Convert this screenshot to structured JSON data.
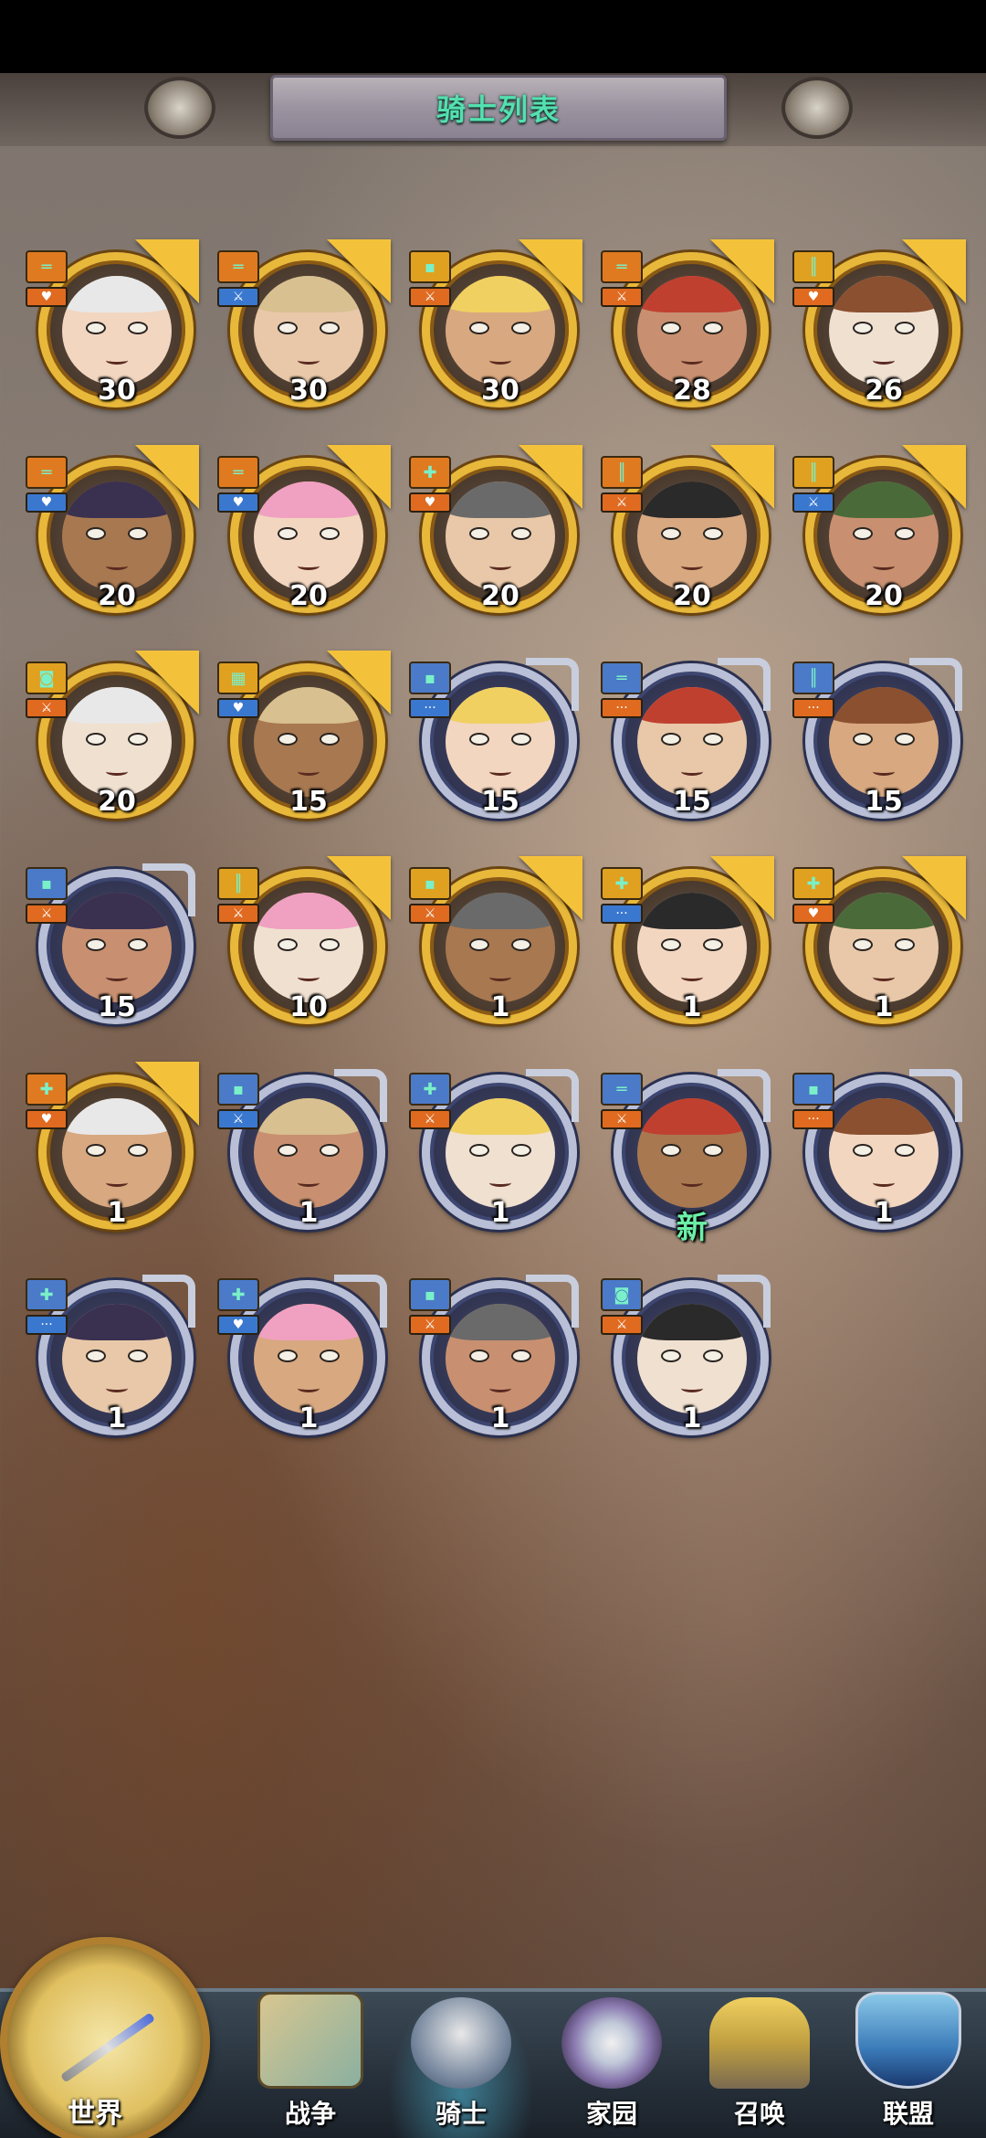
{
  "header": {
    "title": "骑士列表"
  },
  "colors": {
    "rank_green": "#35b58a",
    "rank_gold": "#e0a020",
    "rank_blue": "#4a7ac8",
    "class_orange": "#e06a20",
    "class_blue": "#3a78d0"
  },
  "heroes": [
    {
      "level": "30",
      "frame": "gold",
      "rank": "orange",
      "role": "orange",
      "rank_icon": "bars",
      "role_icon": "heart-icon"
    },
    {
      "level": "30",
      "frame": "gold",
      "rank": "orange",
      "role": "blue",
      "rank_icon": "bars",
      "role_icon": "sword-icon"
    },
    {
      "level": "30",
      "frame": "gold",
      "rank": "gold",
      "role": "orange",
      "rank_icon": "square",
      "role_icon": "sword-icon"
    },
    {
      "level": "28",
      "frame": "gold",
      "rank": "orange",
      "role": "orange",
      "rank_icon": "bars",
      "role_icon": "sword-icon"
    },
    {
      "level": "26",
      "frame": "gold",
      "rank": "gold",
      "role": "orange",
      "rank_icon": "column",
      "role_icon": "heart-icon"
    },
    {
      "level": "20",
      "frame": "gold",
      "rank": "orange",
      "role": "blue",
      "rank_icon": "bars",
      "role_icon": "heart-icon"
    },
    {
      "level": "20",
      "frame": "gold",
      "rank": "orange",
      "role": "blue",
      "rank_icon": "bars",
      "role_icon": "heart-icon"
    },
    {
      "level": "20",
      "frame": "gold",
      "rank": "orange",
      "role": "orange",
      "rank_icon": "cross",
      "role_icon": "heart-icon"
    },
    {
      "level": "20",
      "frame": "gold",
      "rank": "orange",
      "role": "orange",
      "rank_icon": "column",
      "role_icon": "sword-icon"
    },
    {
      "level": "20",
      "frame": "gold",
      "rank": "gold",
      "role": "blue",
      "rank_icon": "column",
      "role_icon": "sword-icon"
    },
    {
      "level": "20",
      "frame": "gold",
      "rank": "gold",
      "role": "orange",
      "rank_icon": "badge",
      "role_icon": "sword-icon"
    },
    {
      "level": "15",
      "frame": "gold",
      "rank": "gold",
      "role": "blue",
      "rank_icon": "grid",
      "role_icon": "heart-icon"
    },
    {
      "level": "15",
      "frame": "silver",
      "rank": "blue",
      "role": "blue",
      "rank_icon": "square",
      "role_icon": "dots-icon"
    },
    {
      "level": "15",
      "frame": "silver",
      "rank": "blue",
      "role": "orange",
      "rank_icon": "bars",
      "role_icon": "dots-icon"
    },
    {
      "level": "15",
      "frame": "silver",
      "rank": "blue",
      "role": "orange",
      "rank_icon": "column",
      "role_icon": "dots-icon"
    },
    {
      "level": "15",
      "frame": "silver",
      "rank": "blue",
      "role": "orange",
      "rank_icon": "square",
      "role_icon": "sword-icon"
    },
    {
      "level": "10",
      "frame": "gold",
      "rank": "gold",
      "role": "orange",
      "rank_icon": "column",
      "role_icon": "sword-icon"
    },
    {
      "level": "1",
      "frame": "gold",
      "rank": "gold",
      "role": "orange",
      "rank_icon": "square",
      "role_icon": "sword-icon"
    },
    {
      "level": "1",
      "frame": "gold",
      "rank": "gold",
      "role": "blue",
      "rank_icon": "cross",
      "role_icon": "dots-icon"
    },
    {
      "level": "1",
      "frame": "gold",
      "rank": "gold",
      "role": "orange",
      "rank_icon": "cross",
      "role_icon": "heart-icon"
    },
    {
      "level": "1",
      "frame": "gold",
      "rank": "orange",
      "role": "orange",
      "rank_icon": "cross",
      "role_icon": "heart-icon"
    },
    {
      "level": "1",
      "frame": "silver",
      "rank": "blue",
      "role": "blue",
      "rank_icon": "square",
      "role_icon": "sword-icon"
    },
    {
      "level": "1",
      "frame": "silver",
      "rank": "blue",
      "role": "orange",
      "rank_icon": "cross",
      "role_icon": "sword-icon"
    },
    {
      "level": "新",
      "frame": "silver",
      "rank": "blue",
      "role": "orange",
      "rank_icon": "bars",
      "role_icon": "sword-icon",
      "is_new": true
    },
    {
      "level": "1",
      "frame": "silver",
      "rank": "blue",
      "role": "orange",
      "rank_icon": "square",
      "role_icon": "dots-icon"
    },
    {
      "level": "1",
      "frame": "silver",
      "rank": "blue",
      "role": "blue",
      "rank_icon": "cross",
      "role_icon": "dots-icon"
    },
    {
      "level": "1",
      "frame": "silver",
      "rank": "blue",
      "role": "blue",
      "rank_icon": "cross",
      "role_icon": "heart-icon"
    },
    {
      "level": "1",
      "frame": "silver",
      "rank": "blue",
      "role": "orange",
      "rank_icon": "square",
      "role_icon": "sword-icon"
    },
    {
      "level": "1",
      "frame": "silver",
      "rank": "blue",
      "role": "orange",
      "rank_icon": "badge",
      "role_icon": "sword-icon"
    }
  ],
  "nav": {
    "world": "世界",
    "items": [
      {
        "label": "战争",
        "icon": "map-icon"
      },
      {
        "label": "骑士",
        "icon": "knight-icon",
        "active": true
      },
      {
        "label": "家园",
        "icon": "gear-icon"
      },
      {
        "label": "召唤",
        "icon": "shrine-icon"
      },
      {
        "label": "联盟",
        "icon": "shield-icon"
      }
    ]
  }
}
